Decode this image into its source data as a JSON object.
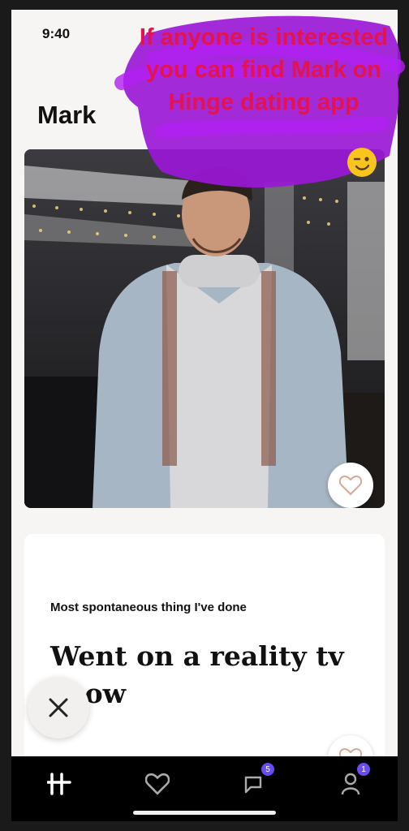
{
  "status": {
    "time": "9:40"
  },
  "profile": {
    "name": "Mark",
    "prompt": {
      "question": "Most spontaneous thing I've done",
      "answer": "Went on a reality tv show"
    }
  },
  "story_overlay": {
    "text": "If anyone is interested you can find Mark on Hinge dating app",
    "emoji": "winking-face"
  },
  "tabs": [
    {
      "name": "home",
      "icon": "hinge-logo-icon",
      "badge": ""
    },
    {
      "name": "likes",
      "icon": "heart-icon",
      "badge": ""
    },
    {
      "name": "matches",
      "icon": "chat-icon",
      "badge": "5"
    },
    {
      "name": "profile",
      "icon": "profile-icon",
      "badge": "1"
    }
  ],
  "colors": {
    "tab_bar": "#000000",
    "badge": "#6b4cf3",
    "scribble": "#9b18d6",
    "story_text": "#e4134f"
  }
}
